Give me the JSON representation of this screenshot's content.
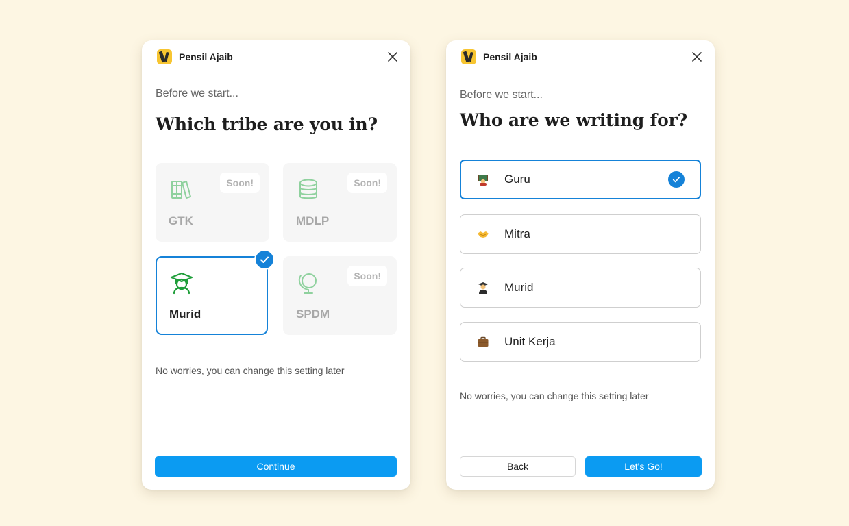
{
  "left_panel": {
    "app_title": "Pensil Ajaib",
    "eyebrow": "Before we start...",
    "heading": "Which tribe are you in?",
    "tiles": [
      {
        "label": "GTK",
        "badge": "Soon!",
        "icon": "books-icon",
        "selected": false
      },
      {
        "label": "MDLP",
        "badge": "Soon!",
        "icon": "database-icon",
        "selected": false
      },
      {
        "label": "Murid",
        "badge": "",
        "icon": "graduate-icon",
        "selected": true
      },
      {
        "label": "SPDM",
        "badge": "Soon!",
        "icon": "globe-icon",
        "selected": false
      }
    ],
    "note": "No worries, you can change this setting later",
    "continue_label": "Continue"
  },
  "right_panel": {
    "app_title": "Pensil Ajaib",
    "eyebrow": "Before we start...",
    "heading": "Who are we writing for?",
    "options": [
      {
        "label": "Guru",
        "icon": "teacher-emoji-icon",
        "selected": true
      },
      {
        "label": "Mitra",
        "icon": "handshake-emoji-icon",
        "selected": false
      },
      {
        "label": "Murid",
        "icon": "student-emoji-icon",
        "selected": false
      },
      {
        "label": "Unit Kerja",
        "icon": "briefcase-emoji-icon",
        "selected": false
      }
    ],
    "note": "No worries, you can change this setting later",
    "back_label": "Back",
    "go_label": "Let's Go!"
  },
  "colors": {
    "background": "#fdf6e3",
    "accent": "#1582d8",
    "primary_button": "#0b9bf2",
    "disabled_icon": "#8fd19e",
    "active_icon": "#1f9e3a"
  }
}
